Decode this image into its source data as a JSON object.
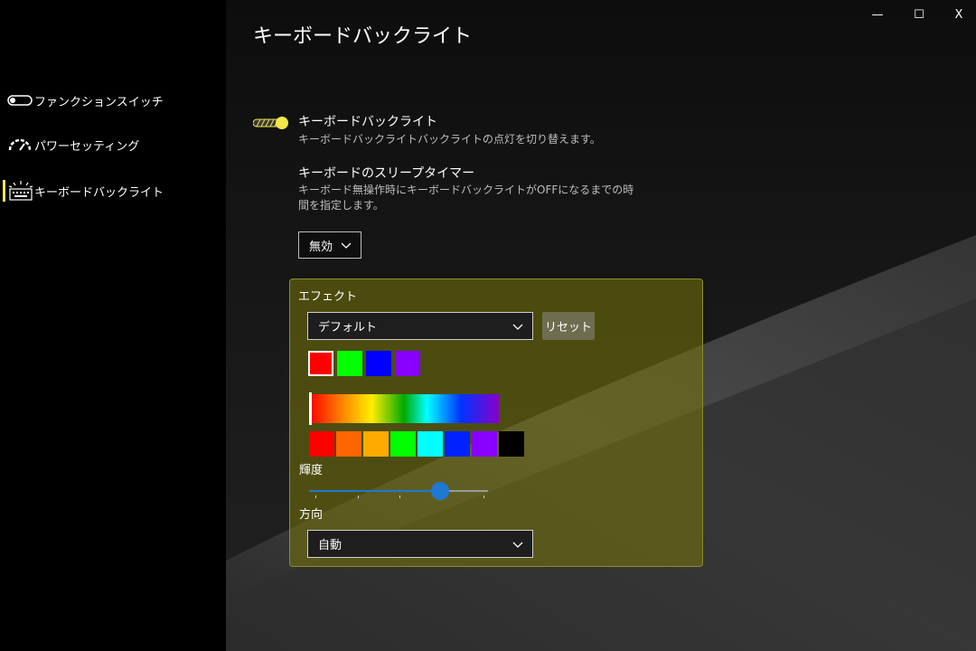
{
  "window": {
    "minimize": "—",
    "maximize": "☐",
    "close": "X"
  },
  "page_title": "キーボードバックライト",
  "sidebar": {
    "items": [
      {
        "label": "ファンクションスイッチ",
        "icon": "toggle-icon"
      },
      {
        "label": "パワーセッティング",
        "icon": "gauge-icon"
      },
      {
        "label": "キーボードバックライト",
        "icon": "keyboard-backlight-icon",
        "active": true
      }
    ]
  },
  "backlight": {
    "title": "キーボードバックライト",
    "desc": "キーボードバックライトバックライトの点灯を切り替えます。",
    "toggle_on": true,
    "toggle_color": "#f2e74b"
  },
  "sleep_timer": {
    "title": "キーボードのスリープタイマー",
    "desc_line1": "キーボード無操作時にキーボードバックライトがOFFになるまでの時",
    "desc_line2": "間を指定します。",
    "value": "無効"
  },
  "effect": {
    "label": "エフェクト",
    "value": "デフォルト",
    "reset_label": "リセット",
    "selected_colors": [
      "#ff0000",
      "#00ff00",
      "#0000ff",
      "#8800ff"
    ],
    "spectrum_position": 0.0,
    "presets": [
      "#ff0000",
      "#ff6600",
      "#ffaa00",
      "#00ff00",
      "#00ffff",
      "#0022ff",
      "#8800ff",
      "#000000"
    ]
  },
  "brightness": {
    "label": "輝度",
    "value": 0.73,
    "ticks": 5
  },
  "direction": {
    "label": "方向",
    "value": "自動"
  },
  "accent_color": "#1f78d1"
}
